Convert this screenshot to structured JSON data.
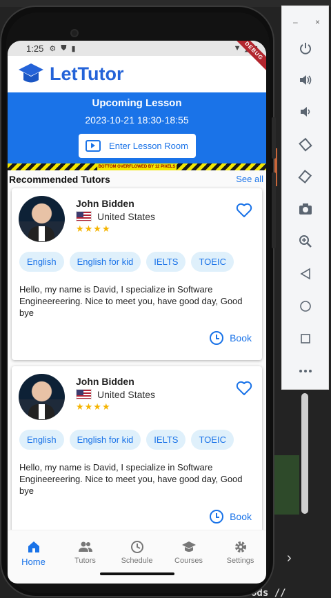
{
  "status_bar": {
    "time": "1:25",
    "debug_label": "DEBUG"
  },
  "app": {
    "name": "LetTutor",
    "brand_color": "#2463d8",
    "accent_color": "#1a73e8"
  },
  "upcoming": {
    "title": "Upcoming Lesson",
    "datetime": "2023-10-21 18:30-18:55",
    "button_label": "Enter Lesson Room"
  },
  "overflow_warning": "BOTTOM OVERFLOWED BY 12 PIXELS",
  "recommended": {
    "title": "Recommended Tutors",
    "see_all": "See all"
  },
  "tutors": [
    {
      "name": "John Bidden",
      "country": "United States",
      "rating_stars": 4,
      "stars_text": "★★★★",
      "tags": [
        "English",
        "English for kid",
        "IELTS",
        "TOEIC"
      ],
      "description": "Hello, my name is David, I specialize in Software Engineereering. Nice to meet you, have good day, Good bye",
      "book_label": "Book"
    },
    {
      "name": "John Bidden",
      "country": "United States",
      "rating_stars": 4,
      "stars_text": "★★★★",
      "tags": [
        "English",
        "English for kid",
        "IELTS",
        "TOEIC"
      ],
      "description": "Hello, my name is David, I specialize in Software Engineereering. Nice to meet you, have good day, Good bye",
      "book_label": "Book"
    }
  ],
  "bottom_nav": [
    {
      "label": "Home",
      "icon": "home-icon",
      "active": true
    },
    {
      "label": "Tutors",
      "icon": "people-icon",
      "active": false
    },
    {
      "label": "Schedule",
      "icon": "clock-icon",
      "active": false
    },
    {
      "label": "Courses",
      "icon": "graduation-cap-icon",
      "active": false
    },
    {
      "label": "Settings",
      "icon": "gear-icon",
      "active": false
    }
  ],
  "emulator_toolbar": {
    "minimize": "–",
    "close": "×",
    "buttons": [
      "power-icon",
      "volume-up-icon",
      "volume-down-icon",
      "rotate-left-icon",
      "rotate-right-icon",
      "camera-icon",
      "zoom-icon",
      "back-icon",
      "home-circle-icon",
      "overview-square-icon",
      "more-icon"
    ]
  },
  "background_text": "ods //"
}
